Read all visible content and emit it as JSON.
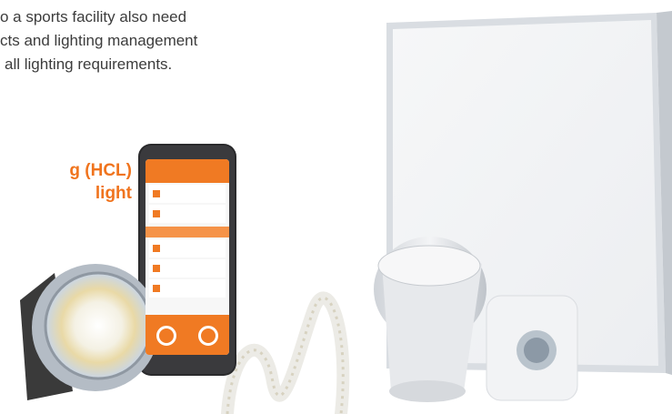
{
  "intro_lines": [
    "o a sports facility also need",
    "cts and lighting management",
    "all lighting requirements."
  ],
  "headline_lines": [
    "g (HCL)",
    "light"
  ],
  "colors": {
    "accent": "#f0741e",
    "text": "#3c3c3c",
    "background": "#ffffff"
  },
  "products": [
    {
      "name": "tunable-white-spotlight",
      "icon": "spotlight-icon"
    },
    {
      "name": "smartphone-app",
      "icon": "smartphone-icon"
    },
    {
      "name": "led-strip",
      "icon": "led-strip-icon"
    },
    {
      "name": "downlight",
      "icon": "downlight-icon"
    },
    {
      "name": "led-panel",
      "icon": "panel-icon"
    },
    {
      "name": "motion-sensor",
      "icon": "sensor-icon"
    }
  ]
}
